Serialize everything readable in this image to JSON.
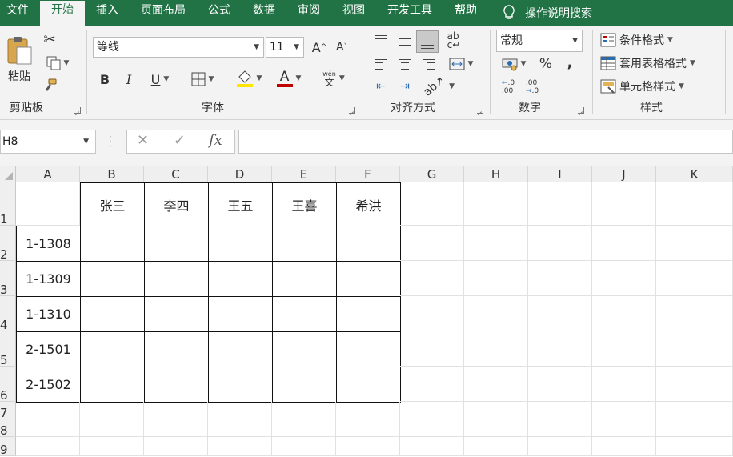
{
  "menu": {
    "items": [
      "文件",
      "开始",
      "插入",
      "页面布局",
      "公式",
      "数据",
      "审阅",
      "视图",
      "开发工具",
      "帮助"
    ],
    "active_index": 1,
    "tell_me": "操作说明搜索"
  },
  "ribbon": {
    "clipboard": {
      "paste_label": "粘贴",
      "group_label": "剪贴板"
    },
    "font": {
      "font_name": "等线",
      "font_size": "11",
      "group_label": "字体",
      "bold": "B",
      "italic": "I",
      "underline": "U",
      "grow": "A",
      "shrink": "A",
      "font_color": "A",
      "phonetic_top": "wén",
      "phonetic_bottom": "文"
    },
    "alignment": {
      "group_label": "对齐方式"
    },
    "number": {
      "format": "常规",
      "percent": "%",
      "comma": ",",
      "group_label": "数字"
    },
    "styles": {
      "conditional": "条件格式",
      "table": "套用表格格式",
      "cell_styles": "单元格样式",
      "group_label": "样式"
    }
  },
  "formula_bar": {
    "name_box": "H8",
    "fx": "fx",
    "formula": ""
  },
  "sheet": {
    "columns": [
      "A",
      "B",
      "C",
      "D",
      "E",
      "F",
      "G",
      "H",
      "I",
      "J",
      "K"
    ],
    "rows": [
      "1",
      "2",
      "3",
      "4",
      "5",
      "6",
      "7",
      "8",
      "9"
    ],
    "header_row": [
      "",
      "张三",
      "李四",
      "王五",
      "王喜",
      "希洪"
    ],
    "row_labels": [
      "1-1308",
      "1-1309",
      "1-1310",
      "2-1501",
      "2-1502"
    ]
  },
  "colors": {
    "brand": "#217346",
    "ribbon_bg": "#f3f3f3",
    "header_bg": "#efefef"
  }
}
